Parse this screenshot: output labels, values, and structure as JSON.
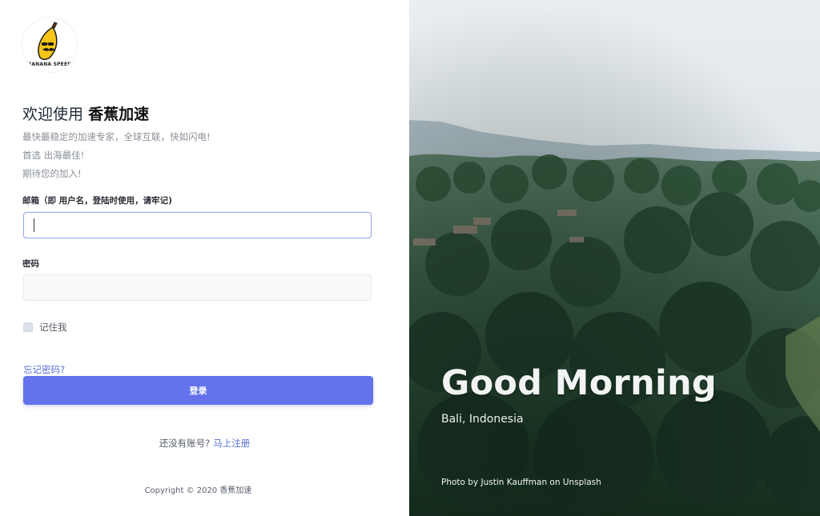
{
  "logo": {
    "alt_text": "BANANA SPEED",
    "icon": "banana-logo-icon"
  },
  "welcome": {
    "prefix": "欢迎使用",
    "brand": "香蕉加速"
  },
  "taglines": [
    "最快最稳定的加速专家，全球互联，快如闪电!",
    "首选 出海最佳!",
    "期待您的加入!"
  ],
  "form": {
    "email_label": "邮箱（即 用户名，登陆时使用，请牢记)",
    "email_value": "",
    "email_placeholder": "",
    "password_label": "密码",
    "password_value": "",
    "password_placeholder": "",
    "remember_label": "记住我",
    "remember_checked": false,
    "forgot_label": "忘记密码?",
    "login_label": "登录"
  },
  "signup": {
    "prompt": "还没有账号?",
    "link": "马上注册"
  },
  "copyright": "Copyright © 2020 香蕉加速",
  "hero": {
    "title": "Good Morning",
    "subtitle": "Bali, Indonesia",
    "credit": "Photo by Justin Kauffman on Unsplash"
  },
  "colors": {
    "accent": "#6472ec",
    "link": "#5a6fd6",
    "forest_dark": "#1f3a2b",
    "sky": "#dfe5ea"
  }
}
